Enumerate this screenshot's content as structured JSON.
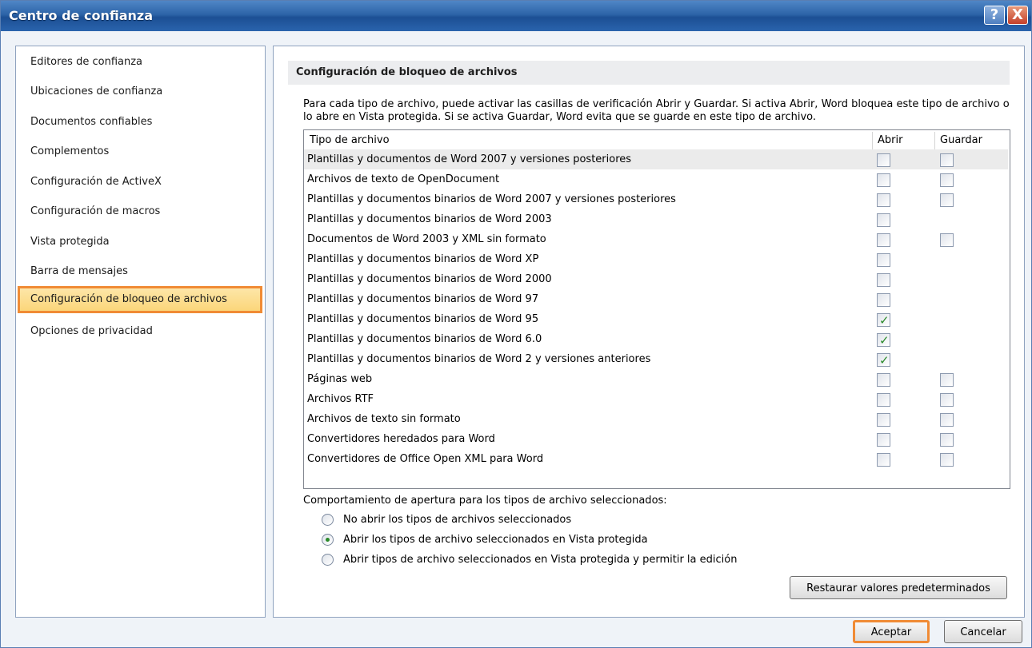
{
  "window": {
    "title": "Centro de confianza",
    "help_glyph": "?",
    "close_glyph": "X"
  },
  "sidebar": {
    "items": [
      {
        "label": "Editores de confianza"
      },
      {
        "label": "Ubicaciones de confianza"
      },
      {
        "label": "Documentos confiables"
      },
      {
        "label": "Complementos"
      },
      {
        "label": "Configuración de ActiveX"
      },
      {
        "label": "Configuración de macros"
      },
      {
        "label": "Vista protegida"
      },
      {
        "label": "Barra de mensajes"
      },
      {
        "label": "Configuración de bloqueo de archivos",
        "selected": true
      },
      {
        "label": "Opciones de privacidad"
      }
    ]
  },
  "main": {
    "section_title": "Configuración de bloqueo de archivos",
    "description": "Para cada tipo de archivo, puede activar las casillas de verificación Abrir y Guardar. Si activa Abrir, Word bloquea este tipo de archivo o lo abre en Vista protegida. Si se activa Guardar, Word evita que se guarde en este tipo de archivo.",
    "table": {
      "headers": [
        "Tipo de archivo",
        "Abrir",
        "Guardar"
      ],
      "rows": [
        {
          "label": "Plantillas y documentos de Word 2007 y versiones posteriores",
          "abrir": false,
          "guardar": false
        },
        {
          "label": "Archivos de texto de OpenDocument",
          "abrir": false,
          "guardar": false
        },
        {
          "label": "Plantillas y documentos binarios de Word 2007 y versiones posteriores",
          "abrir": false,
          "guardar": false
        },
        {
          "label": "Plantillas y documentos binarios de Word 2003",
          "abrir": false,
          "guardar": null
        },
        {
          "label": "Documentos de Word 2003 y XML sin formato",
          "abrir": false,
          "guardar": false
        },
        {
          "label": "Plantillas y documentos binarios de Word XP",
          "abrir": false,
          "guardar": null
        },
        {
          "label": "Plantillas y documentos binarios de Word 2000",
          "abrir": false,
          "guardar": null
        },
        {
          "label": "Plantillas y documentos binarios de Word 97",
          "abrir": false,
          "guardar": null
        },
        {
          "label": "Plantillas y documentos binarios de Word 95",
          "abrir": true,
          "guardar": null
        },
        {
          "label": "Plantillas y documentos binarios de Word 6.0",
          "abrir": true,
          "guardar": null
        },
        {
          "label": "Plantillas y documentos binarios de Word 2 y versiones anteriores",
          "abrir": true,
          "guardar": null
        },
        {
          "label": "Páginas web",
          "abrir": false,
          "guardar": false
        },
        {
          "label": "Archivos RTF",
          "abrir": false,
          "guardar": false
        },
        {
          "label": "Archivos de texto sin formato",
          "abrir": false,
          "guardar": false
        },
        {
          "label": "Convertidores heredados para Word",
          "abrir": false,
          "guardar": false
        },
        {
          "label": "Convertidores de Office Open XML para Word",
          "abrir": false,
          "guardar": false
        }
      ]
    },
    "behavior_label": "Comportamiento de apertura para los tipos de archivo seleccionados:",
    "options": [
      {
        "label": "No abrir los tipos de archivos seleccionados",
        "selected": false
      },
      {
        "label": "Abrir los tipos de archivo seleccionados en Vista protegida",
        "selected": true
      },
      {
        "label": "Abrir tipos de archivo seleccionados en Vista protegida y permitir la edición",
        "selected": false
      }
    ],
    "restore_button": "Restaurar valores predeterminados"
  },
  "footer": {
    "ok_label": "Aceptar",
    "cancel_label": "Cancelar"
  },
  "colors": {
    "title_bar": "#2d64a8",
    "selection_border": "#f08b35",
    "selection_fill": "#fbd67a",
    "check_mark": "#2a8a2a"
  }
}
